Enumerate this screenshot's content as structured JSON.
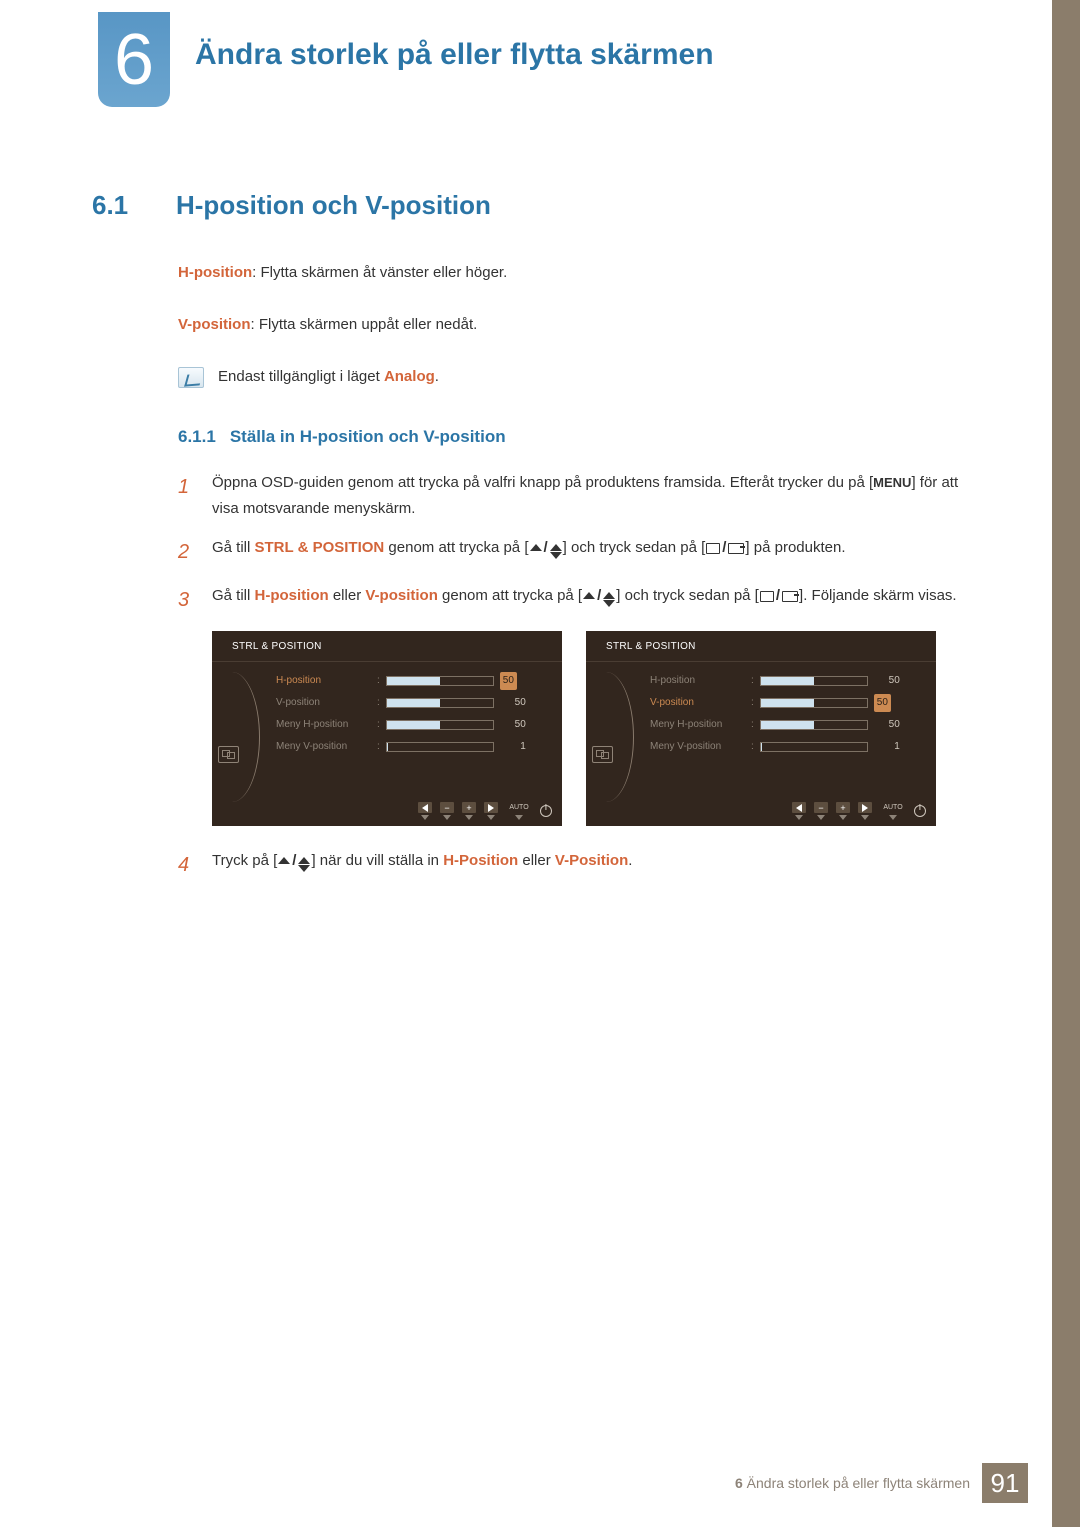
{
  "chapter": {
    "number": "6",
    "title": "Ändra storlek på eller flytta skärmen"
  },
  "section": {
    "number": "6.1",
    "title": "H-position och V-position"
  },
  "descriptions": {
    "h_label": "H-position",
    "h_text": ": Flytta skärmen åt vänster eller höger.",
    "v_label": "V-position",
    "v_text": ": Flytta skärmen uppåt eller nedåt."
  },
  "note": {
    "pre": "Endast tillgängligt i läget ",
    "mode": "Analog",
    "post": "."
  },
  "subsection": {
    "number": "6.1.1",
    "title": "Ställa in H-position och V-position"
  },
  "steps": {
    "s1_pre": "Öppna OSD-guiden genom att trycka på valfri knapp på produktens framsida. Efteråt trycker du på [",
    "s1_menu": "MENU",
    "s1_post": "] för att visa motsvarande menyskärm.",
    "s2_pre": "Gå till ",
    "s2_bold": "STRL & POSITION",
    "s2_mid": " genom att trycka på [",
    "s2_mid2": "] och tryck sedan på [",
    "s2_post": "] på produkten.",
    "s3_pre": "Gå till ",
    "s3_h": "H-position",
    "s3_or": " eller ",
    "s3_v": "V-position",
    "s3_mid": " genom att trycka på [",
    "s3_mid2": "] och tryck sedan på [",
    "s3_post": "]. Följande skärm visas.",
    "s4_pre": "Tryck på [",
    "s4_mid": "] när du vill ställa in ",
    "s4_h": "H-Position",
    "s4_or": " eller ",
    "s4_v": "V-Position",
    "s4_post": "."
  },
  "step_nums": {
    "n1": "1",
    "n2": "2",
    "n3": "3",
    "n4": "4"
  },
  "osd_title": "STRL & POSITION",
  "osd_items": [
    {
      "label": "H-position",
      "value": "50",
      "fill": 50
    },
    {
      "label": "V-position",
      "value": "50",
      "fill": 50
    },
    {
      "label": "Meny H-position",
      "value": "50",
      "fill": 50
    },
    {
      "label": "Meny V-position",
      "value": "1",
      "fill": 1
    }
  ],
  "osd_left_highlight_index": 0,
  "osd_right_highlight_index": 1,
  "osd_buttons": {
    "auto": "AUTO",
    "minus": "−",
    "plus": "+"
  },
  "footer": {
    "text_prefix": "6 ",
    "text": "Ändra storlek på eller flytta skärmen",
    "page": "91"
  }
}
